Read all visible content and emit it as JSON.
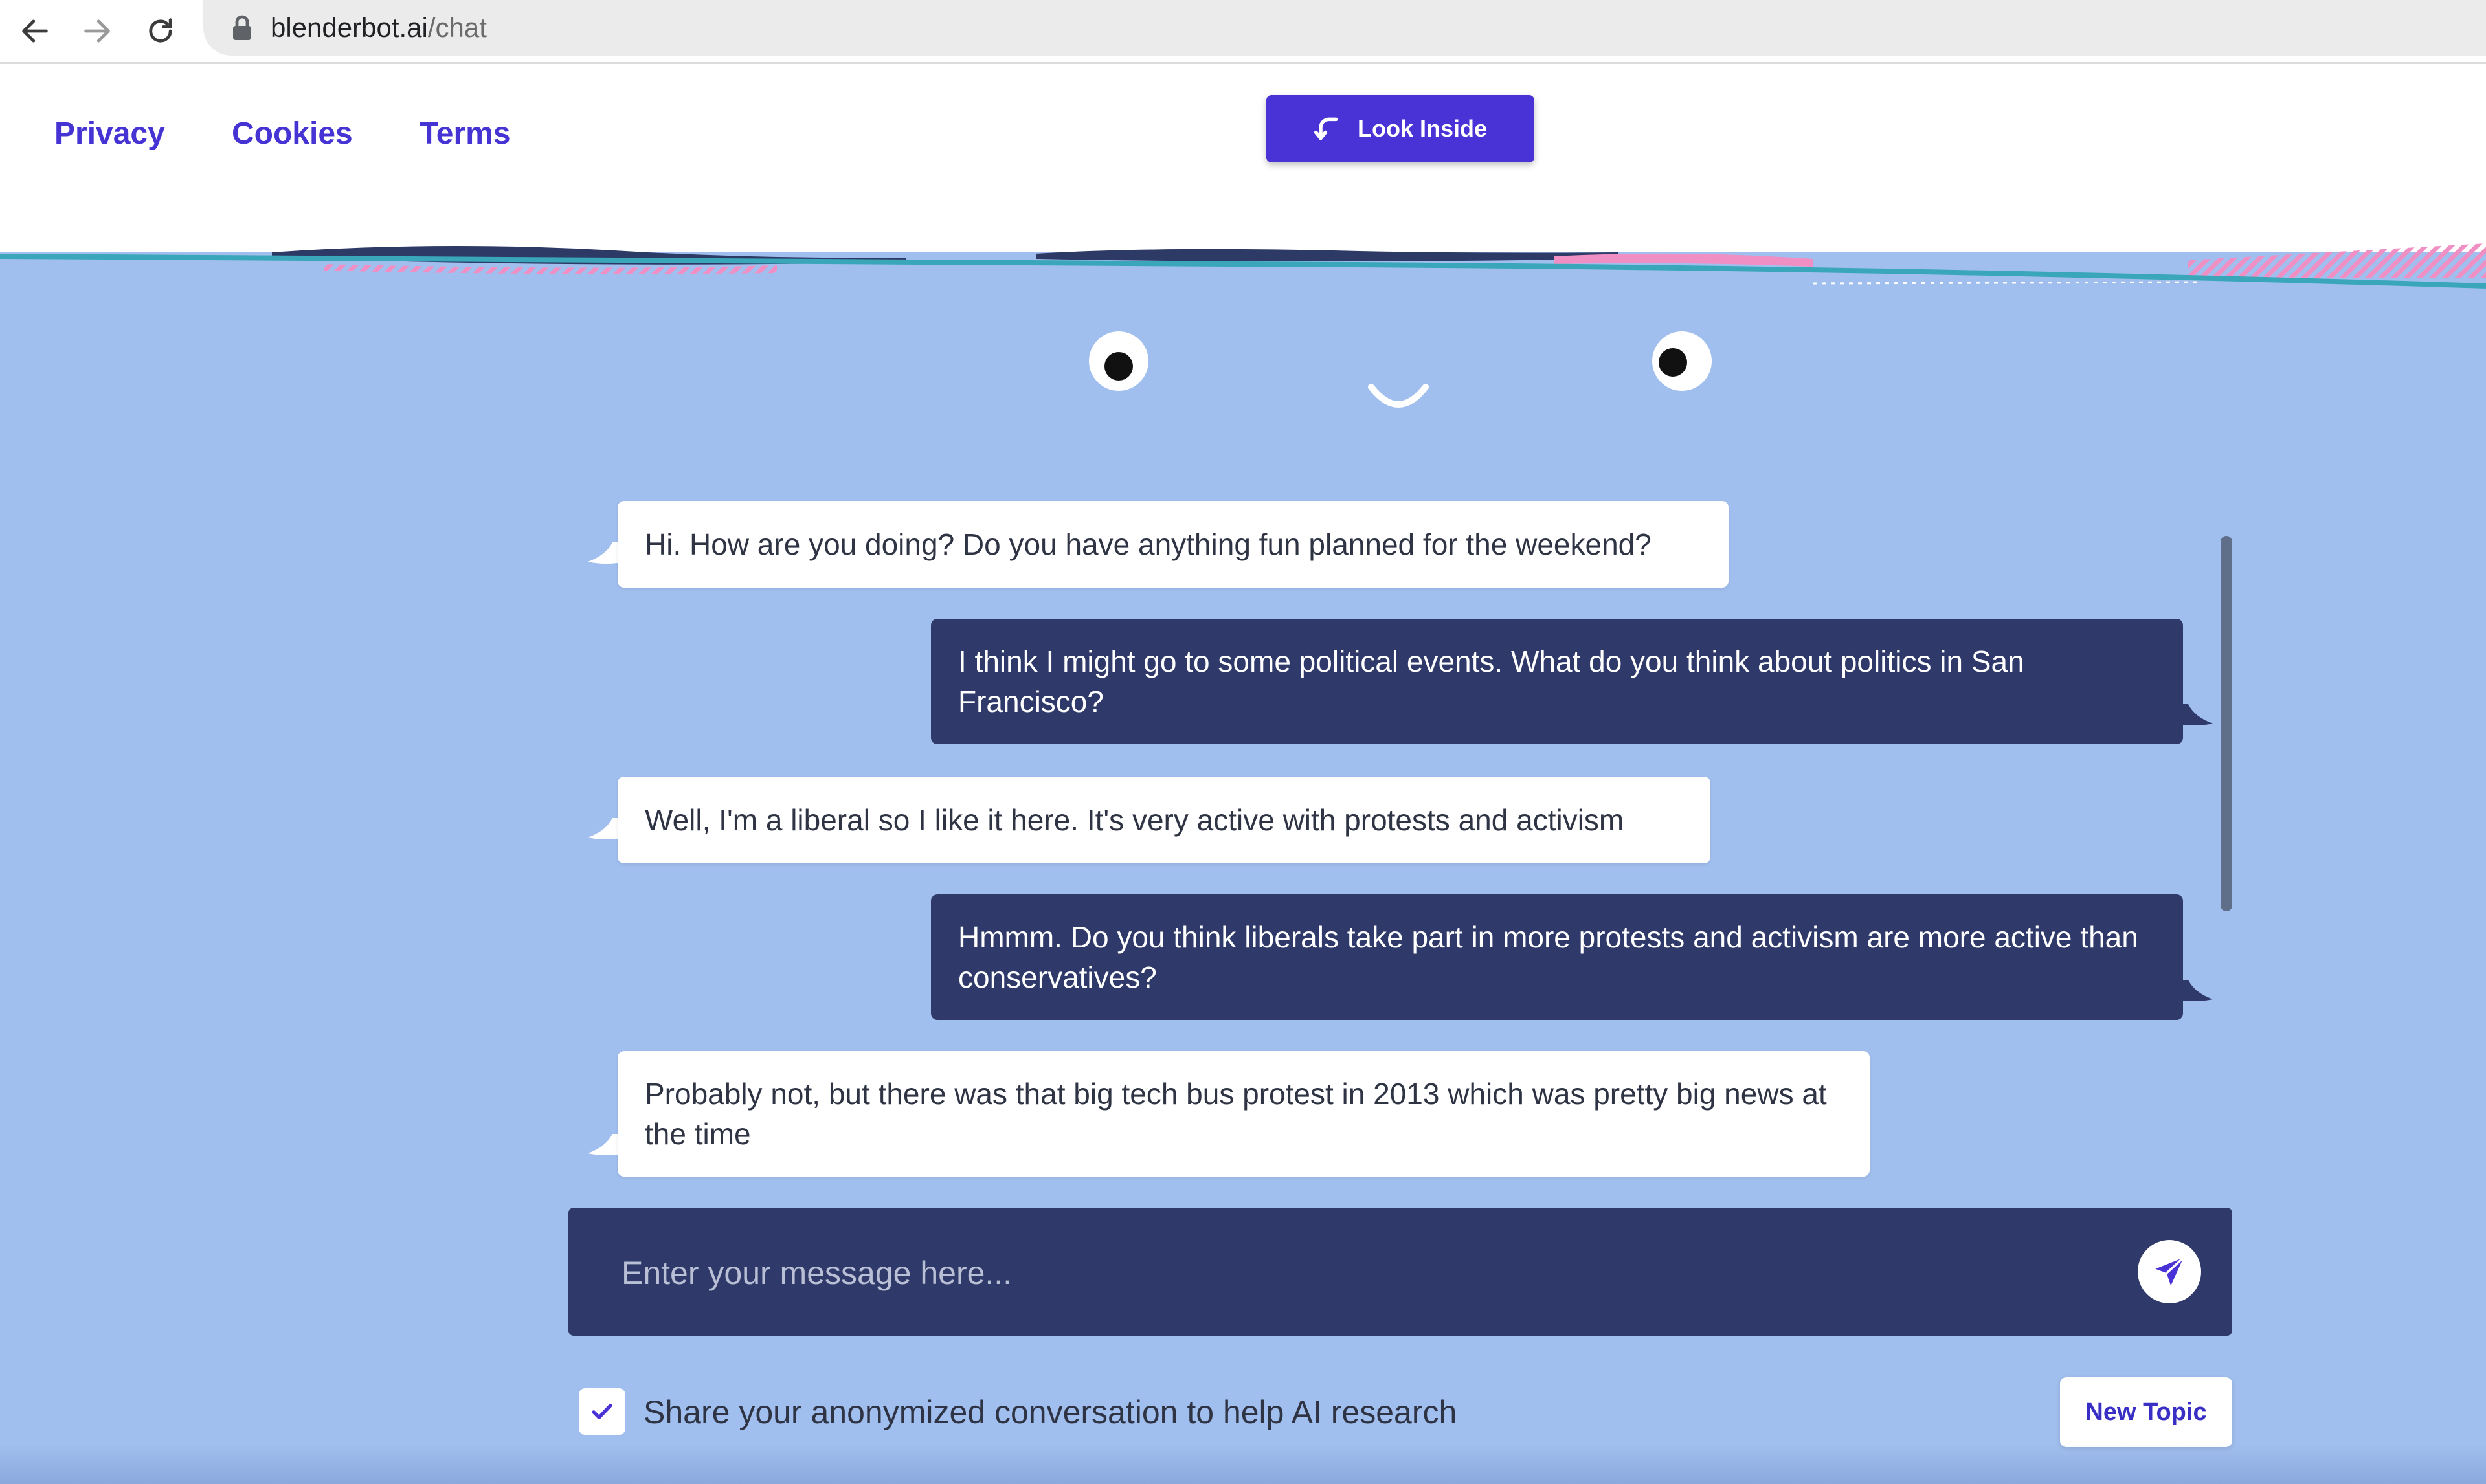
{
  "browser": {
    "url_domain": "blenderbot.ai",
    "url_path": "/chat"
  },
  "header": {
    "links": [
      "Privacy",
      "Cookies",
      "Terms"
    ],
    "look_inside_label": "Look Inside"
  },
  "chat": {
    "messages": [
      {
        "role": "bot",
        "text": "Hi. How are you doing? Do you have anything fun planned for the weekend?"
      },
      {
        "role": "user",
        "text": "I think I might go to some political events. What do you think about politics in San Francisco?"
      },
      {
        "role": "bot",
        "text": "Well, I'm a liberal so I like it here. It's very active with protests and activism"
      },
      {
        "role": "user",
        "text": "Hmmm. Do you think liberals take part in more protests and activism are more active than conservatives?"
      },
      {
        "role": "bot",
        "text": "Probably not, but there was that big tech bus protest in 2013 which was pretty big news at the time"
      }
    ]
  },
  "composer": {
    "placeholder": "Enter your message here...",
    "value": ""
  },
  "footer": {
    "share_label": "Share your anonymized conversation to help AI research",
    "share_checked": true,
    "new_topic_label": "New Topic"
  },
  "colors": {
    "background": "#a1bfee",
    "accent": "#4a33d6",
    "user_bubble": "#2f3a6a",
    "bot_bubble": "#ffffff"
  }
}
